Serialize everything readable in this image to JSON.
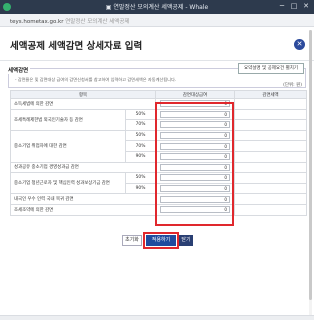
{
  "window": {
    "title": "▣ 연말정산 모의계산 세액공제 - Whale",
    "minimize_glyph": "─",
    "maximize_glyph": "□",
    "close_glyph": "✕"
  },
  "address": {
    "domain": "teys.hometax.go.kr",
    "page_text": "연말정산 모의계산 세액공제"
  },
  "header": {
    "title": "세액공제 세액감면 상세자료 입력",
    "close_glyph": "✕"
  },
  "section": {
    "title": "세액감면",
    "notice": "- 감면율은 및 감면대상 급여의 감면신청서를 참고하여 입력하고 감면세액은 자동계산됩니다.",
    "guide_button": "요약설명 및 공제요건 펼치기"
  },
  "unit": "(단위: 원)",
  "table": {
    "headers": [
      "항목",
      "",
      "감면대상급여",
      "감면세액"
    ],
    "rows": [
      {
        "item": "소득세법에 의한 감면",
        "rate": "",
        "amount": "0"
      },
      {
        "item": "조세특례제한법 외국인기술자 등 감면",
        "rate": "50%",
        "amount": "0"
      },
      {
        "item": "",
        "rate": "70%",
        "amount": "0"
      },
      {
        "item": "",
        "rate": "50%",
        "amount": "0"
      },
      {
        "item": "중소기업 취업자에 대한 감면",
        "rate": "70%",
        "amount": "0"
      },
      {
        "item": "",
        "rate": "90%",
        "amount": "0"
      },
      {
        "item": "성과공유 중소기업 경영성과급 감면",
        "rate": "",
        "amount": "0"
      },
      {
        "item": "중소기업 청년근로자 및 핵심인력 성과보상기금 감면",
        "rate": "50%",
        "amount": "0"
      },
      {
        "item": "",
        "rate": "90%",
        "amount": "0"
      },
      {
        "item": "내국인 우수 인력 국내 복귀 감면",
        "rate": "",
        "amount": "0"
      },
      {
        "item": "조세조약에 의한 감면",
        "rate": "",
        "amount": "0"
      }
    ]
  },
  "buttons": {
    "reset": "초기화",
    "apply": "적용하기",
    "close": "닫기"
  }
}
